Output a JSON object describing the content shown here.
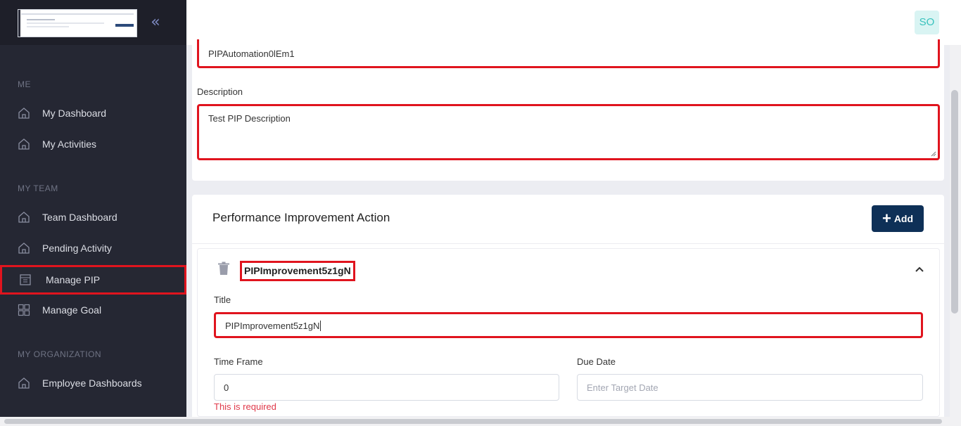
{
  "sidebar": {
    "collapse_icon": "double-chevron-left-icon",
    "sections": {
      "me": "ME",
      "my_team": "MY TEAM",
      "my_org": "MY ORGANIZATION"
    },
    "items": [
      {
        "label": "My Dashboard",
        "icon": "home-icon"
      },
      {
        "label": "My Activities",
        "icon": "home-icon"
      },
      {
        "label": "Team Dashboard",
        "icon": "home-icon"
      },
      {
        "label": "Pending Activity",
        "icon": "home-icon"
      },
      {
        "label": "Manage PIP",
        "icon": "document-icon",
        "active": true
      },
      {
        "label": "Manage Goal",
        "icon": "grid-icon"
      },
      {
        "label": "Employee Dashboards",
        "icon": "home-icon"
      }
    ]
  },
  "header": {
    "avatar_initials": "SO"
  },
  "pip": {
    "name_value": "PIPAutomation0lEm1",
    "description_label": "Description",
    "description_value": "Test PIP Description"
  },
  "actions": {
    "section_title": "Performance Improvement Action",
    "add_label": "Add",
    "item": {
      "heading": "PIPImprovement5z1gN",
      "title_label": "Title",
      "title_value": "PIPImprovement5z1gN",
      "time_frame_label": "Time Frame",
      "time_frame_value": "0",
      "time_frame_error": "This is required",
      "due_date_label": "Due Date",
      "due_date_placeholder": "Enter Target Date"
    }
  },
  "colors": {
    "sidebar_bg": "#252733",
    "highlight_red": "#e0141e",
    "primary_button": "#0e3057",
    "avatar_text": "#38c2bd",
    "error_text": "#e0394a"
  }
}
